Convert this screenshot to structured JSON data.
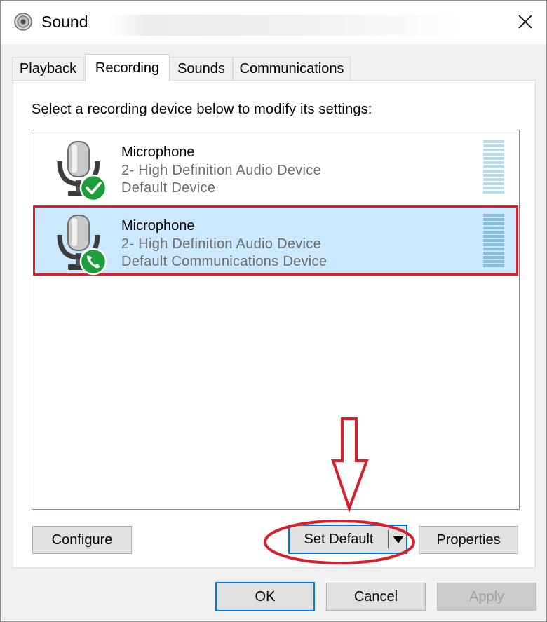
{
  "window": {
    "title": "Sound",
    "close_label": "Close"
  },
  "tabs": [
    {
      "label": "Playback",
      "active": false
    },
    {
      "label": "Recording",
      "active": true
    },
    {
      "label": "Sounds",
      "active": false
    },
    {
      "label": "Communications",
      "active": false
    }
  ],
  "recording": {
    "instruction": "Select a recording device below to modify its settings:",
    "devices": [
      {
        "name": "Microphone",
        "driver": "2- High Definition Audio Device",
        "status": "Default Device",
        "badge": "check-icon",
        "selected": false
      },
      {
        "name": "Microphone",
        "driver": "2- High Definition Audio Device",
        "status": "Default Communications Device",
        "badge": "phone-icon",
        "selected": true
      }
    ]
  },
  "buttons": {
    "configure": "Configure",
    "set_default": "Set Default",
    "properties": "Properties"
  },
  "footer": {
    "ok": "OK",
    "cancel": "Cancel",
    "apply": "Apply"
  },
  "colors": {
    "selection": "#cce8ff",
    "annotation": "#d8202a",
    "focus": "#0078d7",
    "badge_green": "#1e9e3a"
  }
}
